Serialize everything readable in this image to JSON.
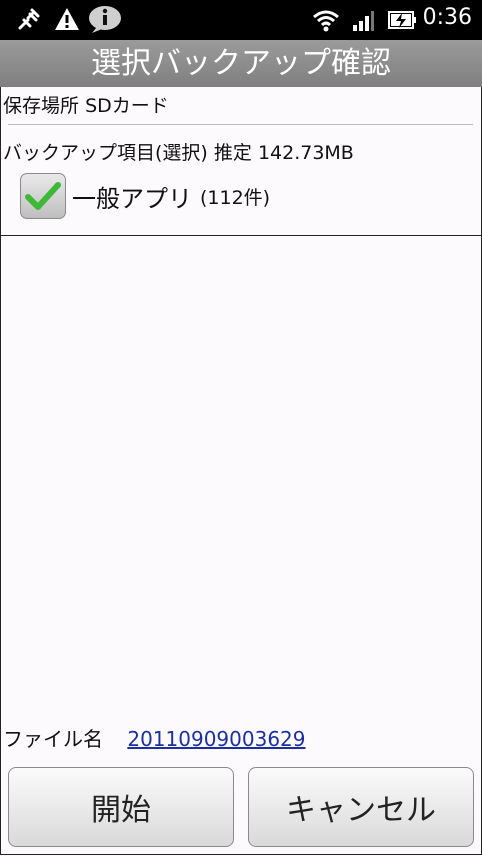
{
  "status_bar": {
    "time": "0:36",
    "icons": [
      "usb-debug-icon",
      "warning-icon",
      "info-icon",
      "wifi-icon",
      "signal-icon",
      "battery-charging-icon"
    ]
  },
  "header": {
    "title": "選択バックアップ確認"
  },
  "location": {
    "label": "保存場所",
    "value": "SDカード"
  },
  "backup_items": {
    "label": "バックアップ項目(選択)",
    "estimate_label": "推定",
    "estimate_value": "142.73MB"
  },
  "apps_checkbox": {
    "label": "一般アプリ",
    "count": "(112件)",
    "checked": true
  },
  "file": {
    "label": "ファイル名",
    "name": "20110909003629"
  },
  "buttons": {
    "start_label": "開始",
    "cancel_label": "キャンセル"
  },
  "colors": {
    "check_green": "#3fb83a",
    "link_blue": "#1c2fa0",
    "title_bar": "#8c8c8c"
  }
}
